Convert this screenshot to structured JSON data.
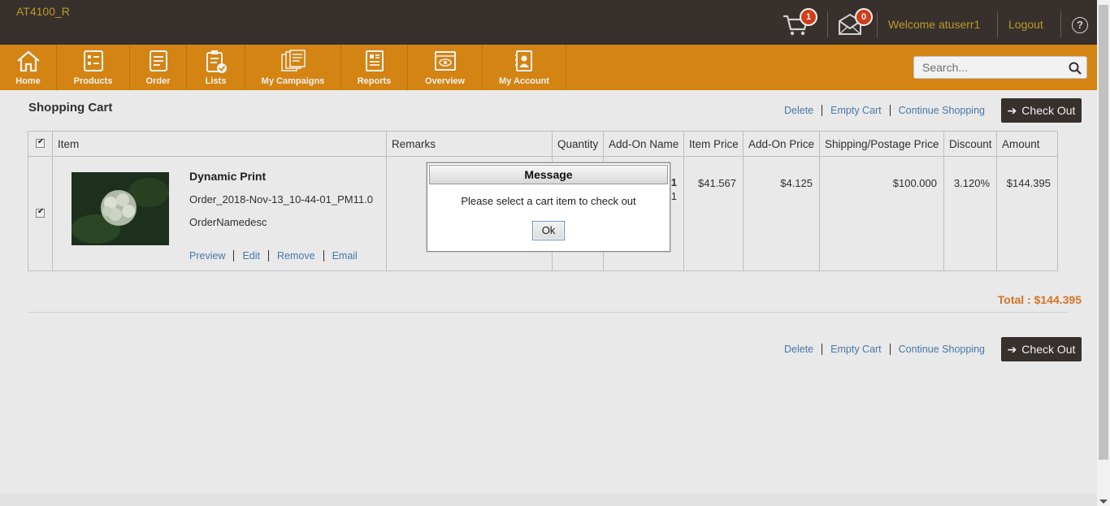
{
  "header": {
    "site_name": "AT4100_R",
    "cart_count": "1",
    "message_count": "0",
    "welcome": "Welcome atuserr1",
    "logout": "Logout",
    "help": "?"
  },
  "nav": {
    "items": [
      {
        "label": "Home",
        "icon": "home-icon"
      },
      {
        "label": "Products",
        "icon": "products-icon"
      },
      {
        "label": "Order",
        "icon": "order-icon"
      },
      {
        "label": "Lists",
        "icon": "lists-icon"
      },
      {
        "label": "My Campaigns",
        "icon": "campaigns-icon"
      },
      {
        "label": "Reports",
        "icon": "reports-icon"
      },
      {
        "label": "Overview",
        "icon": "overview-icon"
      },
      {
        "label": "My Account",
        "icon": "account-icon"
      }
    ],
    "search_placeholder": "Search..."
  },
  "cart": {
    "title": "Shopping Cart",
    "actions": {
      "delete": "Delete",
      "empty_cart": "Empty Cart",
      "continue_shopping": "Continue Shopping",
      "checkout": "Check Out"
    },
    "columns": [
      "Item",
      "Remarks",
      "Quantity",
      "Add-On Name",
      "Item Price",
      "Add-On Price",
      "Shipping/Postage Price",
      "Discount",
      "Amount"
    ],
    "item": {
      "name": "Dynamic Print",
      "order": "Order_2018-Nov-13_10-44-01_PM11.0",
      "description": "OrderNamedesc",
      "links": [
        "Preview",
        "Edit",
        "Remove",
        "Email"
      ],
      "addon_partial_1": "1",
      "addon_partial_2": "1",
      "item_price": "$41.567",
      "addon_price": "$4.125",
      "shipping": "$100.000",
      "discount": "3.120%",
      "amount": "$144.395"
    },
    "total": "Total : $144.395"
  },
  "modal": {
    "title": "Message",
    "message": "Please select a cart item to check out",
    "ok": "Ok"
  },
  "colors": {
    "topbar": "#3a3330",
    "nav": "#e08c15",
    "accent_gold": "#c7a227",
    "link": "#4a7fb5",
    "total": "#e07a2a"
  }
}
